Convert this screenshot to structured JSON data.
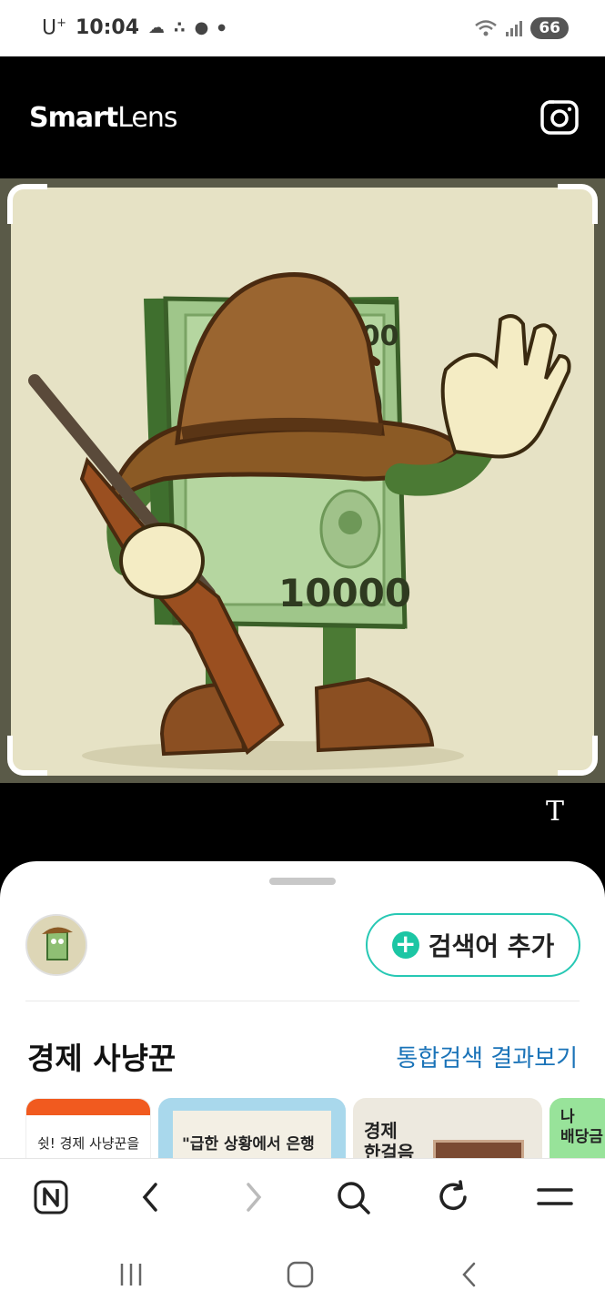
{
  "status": {
    "carrier": "U",
    "carrier_sup": "+",
    "time": "10:04",
    "battery": "66",
    "icons": [
      "cloud-icon",
      "notification-icon",
      "chat-icon",
      "dot-icon",
      "wifi-icon",
      "signal-icon"
    ]
  },
  "header": {
    "logo_bold": "Smart",
    "logo_light": "Lens",
    "camera_icon": "camera-icon"
  },
  "image": {
    "bill_top_number": "1000",
    "bill_bottom_number": "10000"
  },
  "text_tool": "T",
  "sheet": {
    "add_keyword_label": "검색어 추가",
    "query": "경제 사냥꾼",
    "all_results_label": "통합검색 결과보기",
    "cards": [
      {
        "text": "쉿! 경제 사냥꾼을"
      },
      {
        "text": "\"급한 상황에서 은행"
      },
      {
        "text_line1": "경제",
        "text_line2": "한걸음"
      },
      {
        "text_line1": "나",
        "text_line2": "배당금"
      }
    ]
  },
  "toolbar": {
    "icons": [
      "naver-home-icon",
      "back-icon",
      "forward-icon",
      "search-icon",
      "refresh-icon",
      "menu-icon"
    ]
  },
  "colors": {
    "accent_teal": "#1cc6a4",
    "link_blue": "#1a73b8",
    "card_orange": "#f15a1f"
  }
}
